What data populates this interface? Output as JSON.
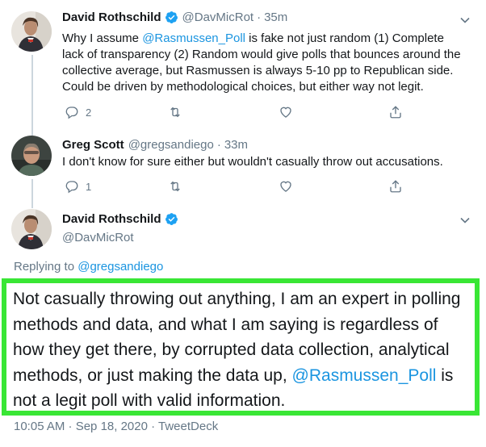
{
  "tweet1": {
    "name": "David Rothschild",
    "handle": "@DavMicRot",
    "time": "35m",
    "text_before": "Why I assume ",
    "mention": "@Rasmussen_Poll",
    "text_after": " is fake not just random (1) Complete lack of transparency (2) Random would give polls that bounces around the collective average, but Rasmussen is always 5-10 pp to Republican side. Could be driven by methodological choices, but either way not legit.",
    "reply_count": "2",
    "retweet_count": "",
    "like_count": ""
  },
  "tweet2": {
    "name": "Greg Scott",
    "handle": "@gregsandiego",
    "time": "33m",
    "text": "I don't know for sure either but wouldn't casually throw out accusations.",
    "reply_count": "1"
  },
  "main_tweet": {
    "name": "David Rothschild",
    "handle": "@DavMicRot",
    "replying_prefix": "Replying to ",
    "replying_to": "@gregsandiego",
    "text_before": "Not casually throwing out anything, I am an expert in polling methods and data, and what I am saying is regardless of how they get there, by corrupted data collection, analytical methods, or just making the data up, ",
    "mention": "@Rasmussen_Poll",
    "text_after": " is not a legit poll with valid information.",
    "timestamp": "10:05 AM · Sep 18, 2020 · TweetDeck"
  },
  "colors": {
    "accent": "#1b95e0",
    "secondary_text": "#657786",
    "highlight_border": "#39e635",
    "verified": "#1da1f2"
  },
  "icons": [
    "reply-icon",
    "retweet-icon",
    "like-icon",
    "share-icon",
    "verified-icon",
    "chevron-down-icon"
  ]
}
